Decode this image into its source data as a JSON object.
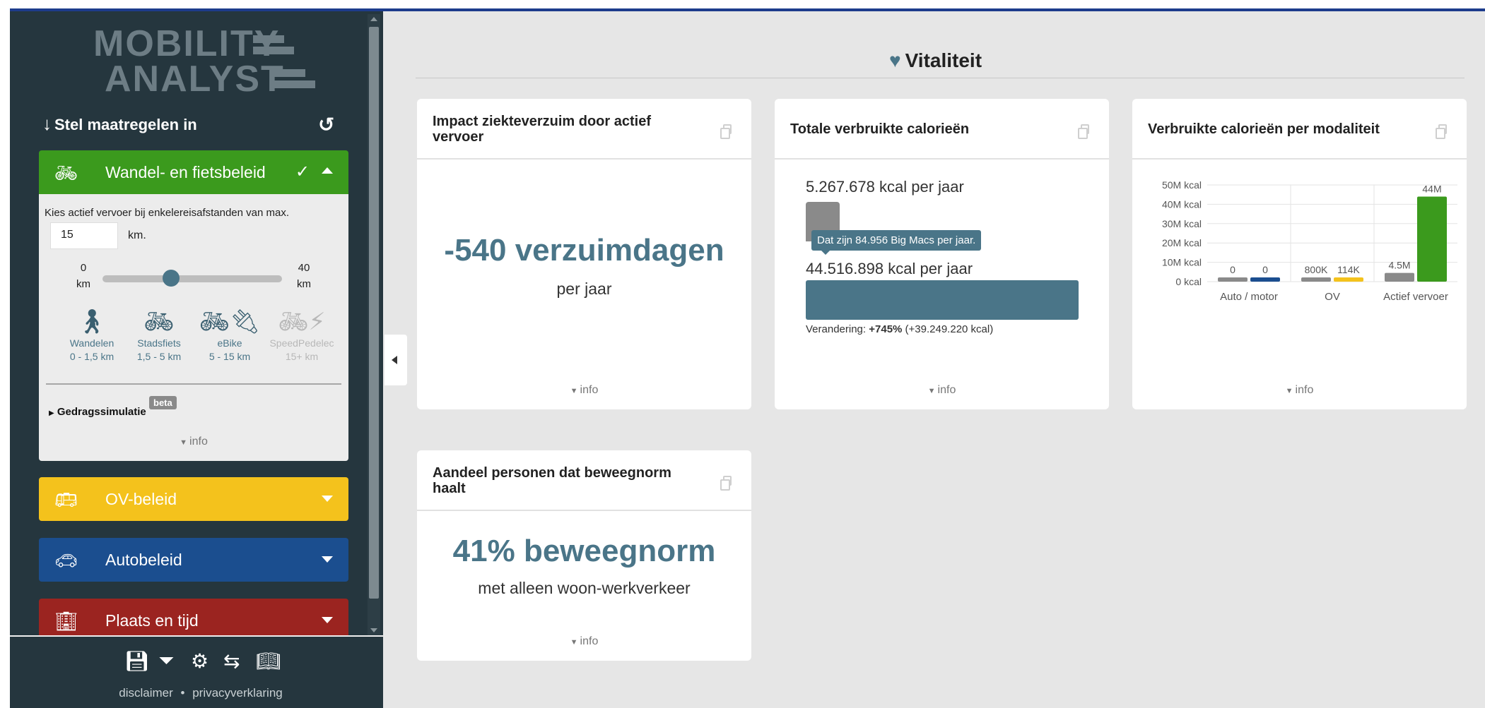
{
  "app": {
    "logo_line1": "MOBILITY",
    "logo_line2": "ANALYST",
    "accent": "#4a7588"
  },
  "sidebar": {
    "heading": "Stel maatregelen in",
    "reset_icon": "reset-icon",
    "sections": [
      {
        "label": "Wandel- en fietsbeleid",
        "color": "#3b9a1d",
        "icon": "bicycle-icon",
        "expanded": true,
        "checked": true
      },
      {
        "label": "OV-beleid",
        "color": "#f4c21c",
        "icon": "bus-icon",
        "expanded": false
      },
      {
        "label": "Autobeleid",
        "color": "#1b4e8f",
        "icon": "car-icon",
        "expanded": false
      },
      {
        "label": "Plaats en tijd",
        "color": "#9b2420",
        "icon": "building-icon",
        "expanded": false
      }
    ],
    "active_body": {
      "instruction": "Kies actief vervoer bij enkelereisafstanden van max.",
      "distance_value": "15",
      "distance_unit": "km.",
      "slider": {
        "min": "0",
        "max": "40",
        "unit": "km",
        "value": 15
      },
      "modes": [
        {
          "name": "Wandelen",
          "range": "0 - 1,5 km",
          "icon": "walking-icon",
          "enabled": true
        },
        {
          "name": "Stadsfiets",
          "range": "1,5 - 5 km",
          "icon": "bicycle-icon",
          "enabled": true
        },
        {
          "name": "eBike",
          "range": "5 - 15 km",
          "icon": "ebike-icon",
          "enabled": true
        },
        {
          "name": "SpeedPedelec",
          "range": "15+ km",
          "icon": "speedpedelec-icon",
          "enabled": false
        }
      ],
      "gedrag_label": "Gedragssimulatie",
      "beta_label": "beta",
      "info_label": "info"
    },
    "footer": {
      "icons": [
        "save-icon",
        "filter-icon",
        "gear-icon",
        "signpost-icon",
        "book-icon"
      ],
      "disclaimer": "disclaimer",
      "separator": "•",
      "privacy": "privacyverklaring"
    }
  },
  "main": {
    "title": "Vitaliteit",
    "title_icon": "heart-icon",
    "cards": {
      "verzuim": {
        "title": "Impact ziekteverzuim door actief vervoer",
        "value": "-540 verzuimdagen",
        "subtitle": "per jaar",
        "info": "info"
      },
      "calorieen": {
        "title": "Totale verbruikte calorieën",
        "before": "5.267.678 kcal per jaar",
        "tooltip": "Dat zijn 84.956 Big Macs per jaar.",
        "after": "44.516.898 kcal per jaar",
        "change_label": "Verandering:",
        "change_pct": "+745%",
        "change_abs": "(+39.249.220 kcal)",
        "info": "info"
      },
      "modaliteit": {
        "title": "Verbruikte calorieën per modaliteit",
        "info": "info"
      },
      "beweegnorm": {
        "title": "Aandeel personen dat beweegnorm haalt",
        "value": "41% beweegnorm",
        "subtitle": "met alleen woon-werkverkeer",
        "info": "info"
      }
    }
  },
  "chart_data": {
    "type": "bar",
    "title": "Verbruikte calorieën per modaliteit",
    "categories": [
      "Auto / motor",
      "OV",
      "Actief vervoer"
    ],
    "series": [
      {
        "color": "#8a8a8a",
        "values": [
          0,
          800000,
          4500000
        ],
        "labels": [
          "0",
          "800K",
          "4.5M"
        ]
      },
      {
        "color": "#1b4e8f",
        "values": [
          0,
          null,
          null
        ],
        "labels": [
          "0",
          "",
          ""
        ]
      },
      {
        "color": "#f4c21c",
        "values": [
          null,
          114000,
          null
        ],
        "labels": [
          "",
          "114K",
          ""
        ]
      },
      {
        "color": "#3b9a1d",
        "values": [
          null,
          null,
          44000000
        ],
        "labels": [
          "",
          "",
          "44M"
        ]
      }
    ],
    "y_ticks": [
      "0 kcal",
      "10M kcal",
      "20M kcal",
      "30M kcal",
      "40M kcal",
      "50M kcal"
    ],
    "ylim": [
      0,
      50000000
    ],
    "grid": true
  }
}
